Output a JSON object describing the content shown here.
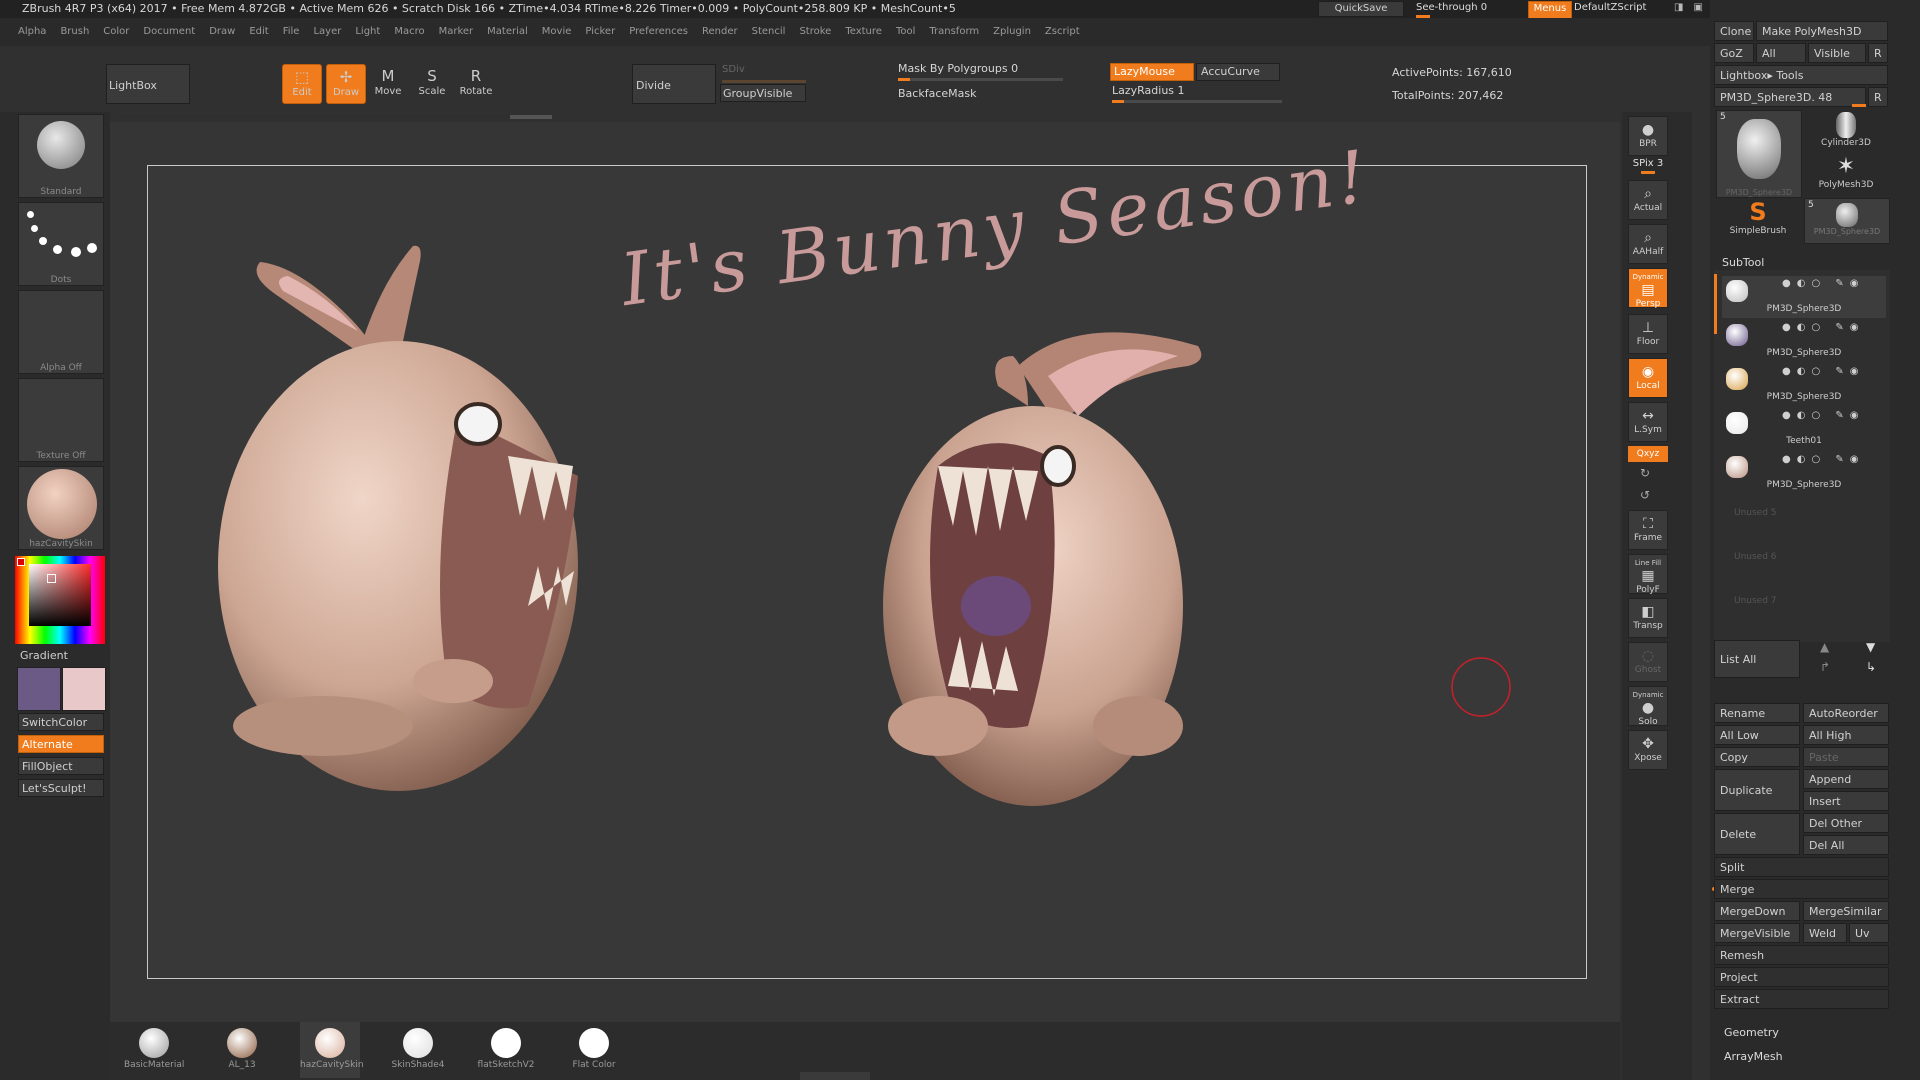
{
  "topbar": {
    "title": "ZBrush 4R7 P3 (x64)   2017    • Free Mem 4.872GB • Active Mem 626 • Scratch Disk 166 •  ZTime•4.034 RTime•8.226 Timer•0.009 • PolyCount•258.809 KP  • MeshCount•5",
    "quicksave": "QuickSave",
    "seethrough": "See-through   0",
    "menus": "Menus",
    "script": "DefaultZScript"
  },
  "menu": [
    "Alpha",
    "Brush",
    "Color",
    "Document",
    "Draw",
    "Edit",
    "File",
    "Layer",
    "Light",
    "Macro",
    "Marker",
    "Material",
    "Movie",
    "Picker",
    "Preferences",
    "Render",
    "Stencil",
    "Stroke",
    "Texture",
    "Tool",
    "Transform",
    "Zplugin",
    "Zscript"
  ],
  "toolbar": {
    "lightbox": "LightBox",
    "edit": "Edit",
    "draw": "Draw",
    "move": "Move",
    "scale": "Scale",
    "rotate": "Rotate",
    "divide": "Divide",
    "sdiv": "SDiv",
    "groupvisible": "GroupVisible",
    "mask_polygroups": "Mask By Polygroups 0",
    "backfacemask": "BackfaceMask",
    "lazymouse": "LazyMouse",
    "accucurve": "AccuCurve",
    "lazyradius": "LazyRadius 1",
    "active_points": "ActivePoints: 167,610",
    "total_points": "TotalPoints: 207,462"
  },
  "left": {
    "brush": "Standard",
    "stroke": "Dots",
    "alpha": "Alpha  Off",
    "texture": "Texture  Off",
    "material": "hazCavitySkin",
    "gradient": "Gradient",
    "switchcolor": "SwitchColor",
    "alternate": "Alternate",
    "fillobject": "FillObject",
    "letssculpt": "Let'sSculpt!"
  },
  "colors": {
    "accent": "#f07c1d",
    "main_color": "#6b5a86",
    "secondary_color": "#e8c8c8",
    "cursor_ring": "#c8202a",
    "handwriting": "#c99a9a"
  },
  "canvas": {
    "handwriting": "It's Bunny Season!"
  },
  "rightshelf": {
    "bpr": "BPR",
    "spix": "SPix 3",
    "actual": "Actual",
    "aahalf": "AAHalf",
    "dynamic": "Dynamic",
    "persp": "Persp",
    "floor": "Floor",
    "local": "Local",
    "lsym": "L.Sym",
    "xyz": "Qxyz",
    "frame": "Frame",
    "linefill": "Line Fill",
    "polyf": "PolyF",
    "transp": "Transp",
    "ghost": "Ghost",
    "dynamic2": "Dynamic",
    "solo": "Solo",
    "xpose": "Xpose"
  },
  "tray": {
    "clone": "Clone",
    "make_polymesh": "Make PolyMesh3D",
    "goz": "GoZ",
    "all": "All",
    "visible": "Visible",
    "r": "R",
    "lightbox_tools": "Lightbox▸ Tools",
    "current_tool": "PM3D_Sphere3D. 48",
    "tools": [
      {
        "name": "PM3D_Sphere3D",
        "count": "5"
      },
      {
        "name": "Cylinder3D",
        "count": ""
      },
      {
        "name": "PolyMesh3D",
        "count": ""
      },
      {
        "name": "SimpleBrush",
        "count": ""
      },
      {
        "name": "PM3D_Sphere3D",
        "count": "5"
      }
    ],
    "subtool_title": "SubTool",
    "subtools": [
      "PM3D_Sphere3D",
      "PM3D_Sphere3D",
      "PM3D_Sphere3D",
      "Teeth01",
      "PM3D_Sphere3D"
    ],
    "unused": [
      "Unused 5",
      "Unused 6",
      "Unused 7"
    ],
    "list_all": "List  All",
    "buttons": {
      "rename": "Rename",
      "autoreorder": "AutoReorder",
      "all_low": "All  Low",
      "all_high": "All  High",
      "copy": "Copy",
      "paste": "Paste",
      "duplicate": "Duplicate",
      "append": "Append",
      "insert": "Insert",
      "delete": "Delete",
      "del_other": "Del  Other",
      "del_all": "Del  All",
      "split": "Split",
      "merge": "Merge",
      "mergedown": "MergeDown",
      "mergesimilar": "MergeSimilar",
      "mergevisible": "MergeVisible",
      "weld": "Weld",
      "uv": "Uv",
      "remesh": "Remesh",
      "project": "Project",
      "extract": "Extract",
      "geometry": "Geometry",
      "arraymesh": "ArrayMesh"
    }
  },
  "materials": [
    {
      "name": "BasicMaterial",
      "color": "#9a9a9a"
    },
    {
      "name": "AL_13",
      "color": "#8a5a3a"
    },
    {
      "name": "hazCavitySkin",
      "color": "#d8ad9a"
    },
    {
      "name": "SkinShade4",
      "color": "#dddddd"
    },
    {
      "name": "flatSketchV2",
      "color": "#ffffff"
    },
    {
      "name": "Flat  Color",
      "color": "#ffffff"
    }
  ]
}
